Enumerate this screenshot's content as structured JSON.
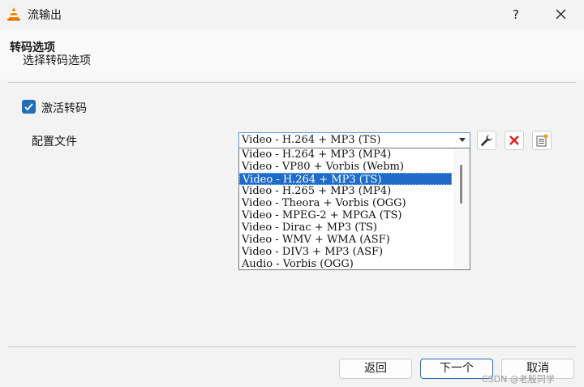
{
  "window": {
    "title": "流输出",
    "help_label": "?"
  },
  "header": {
    "title": "转码选项",
    "subtitle": "选择转码选项"
  },
  "transcode": {
    "activate_label": "激活转码",
    "activate_checked": true
  },
  "profile": {
    "label": "配置文件",
    "selected_value": "Video - H.264 + MP3 (TS)",
    "options": [
      "Video - H.264 + MP3 (MP4)",
      "Video - VP80 + Vorbis (Webm)",
      "Video - H.264 + MP3 (TS)",
      "Video - H.265 + MP3 (MP4)",
      "Video - Theora + Vorbis (OGG)",
      "Video - MPEG-2 + MPGA (TS)",
      "Video - Dirac + MP3 (TS)",
      "Video - WMV + WMA (ASF)",
      "Video - DIV3 + MP3 (ASF)",
      "Audio - Vorbis (OGG)"
    ],
    "highlighted_index": 2,
    "tools": [
      "wrench-icon",
      "delete-x-icon",
      "new-profile-icon"
    ]
  },
  "footer": {
    "back_label": "返回",
    "next_label": "下一个",
    "cancel_label": "取消"
  },
  "watermark": "CSDN @老殷同学",
  "colors": {
    "accent": "#1f6fba",
    "selection": "#1e6cc8",
    "delete_red": "#e02020"
  }
}
